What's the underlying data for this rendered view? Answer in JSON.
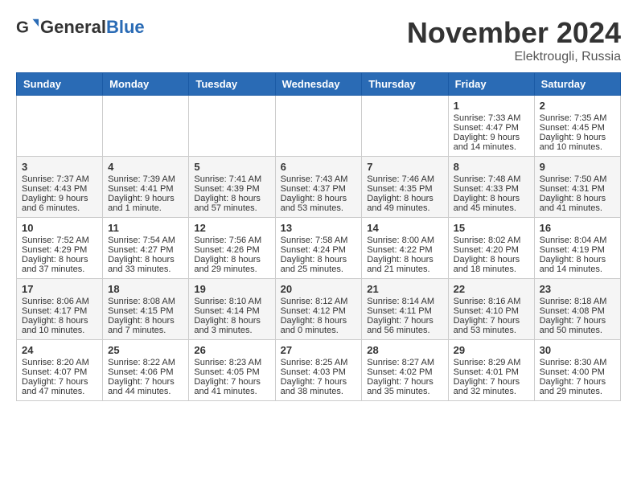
{
  "header": {
    "logo_general": "General",
    "logo_blue": "Blue",
    "month_title": "November 2024",
    "location": "Elektrougli, Russia"
  },
  "calendar": {
    "weekdays": [
      "Sunday",
      "Monday",
      "Tuesday",
      "Wednesday",
      "Thursday",
      "Friday",
      "Saturday"
    ],
    "rows": [
      [
        {
          "day": "",
          "text": ""
        },
        {
          "day": "",
          "text": ""
        },
        {
          "day": "",
          "text": ""
        },
        {
          "day": "",
          "text": ""
        },
        {
          "day": "",
          "text": ""
        },
        {
          "day": "1",
          "text": "Sunrise: 7:33 AM\nSunset: 4:47 PM\nDaylight: 9 hours and 14 minutes."
        },
        {
          "day": "2",
          "text": "Sunrise: 7:35 AM\nSunset: 4:45 PM\nDaylight: 9 hours and 10 minutes."
        }
      ],
      [
        {
          "day": "3",
          "text": "Sunrise: 7:37 AM\nSunset: 4:43 PM\nDaylight: 9 hours and 6 minutes."
        },
        {
          "day": "4",
          "text": "Sunrise: 7:39 AM\nSunset: 4:41 PM\nDaylight: 9 hours and 1 minute."
        },
        {
          "day": "5",
          "text": "Sunrise: 7:41 AM\nSunset: 4:39 PM\nDaylight: 8 hours and 57 minutes."
        },
        {
          "day": "6",
          "text": "Sunrise: 7:43 AM\nSunset: 4:37 PM\nDaylight: 8 hours and 53 minutes."
        },
        {
          "day": "7",
          "text": "Sunrise: 7:46 AM\nSunset: 4:35 PM\nDaylight: 8 hours and 49 minutes."
        },
        {
          "day": "8",
          "text": "Sunrise: 7:48 AM\nSunset: 4:33 PM\nDaylight: 8 hours and 45 minutes."
        },
        {
          "day": "9",
          "text": "Sunrise: 7:50 AM\nSunset: 4:31 PM\nDaylight: 8 hours and 41 minutes."
        }
      ],
      [
        {
          "day": "10",
          "text": "Sunrise: 7:52 AM\nSunset: 4:29 PM\nDaylight: 8 hours and 37 minutes."
        },
        {
          "day": "11",
          "text": "Sunrise: 7:54 AM\nSunset: 4:27 PM\nDaylight: 8 hours and 33 minutes."
        },
        {
          "day": "12",
          "text": "Sunrise: 7:56 AM\nSunset: 4:26 PM\nDaylight: 8 hours and 29 minutes."
        },
        {
          "day": "13",
          "text": "Sunrise: 7:58 AM\nSunset: 4:24 PM\nDaylight: 8 hours and 25 minutes."
        },
        {
          "day": "14",
          "text": "Sunrise: 8:00 AM\nSunset: 4:22 PM\nDaylight: 8 hours and 21 minutes."
        },
        {
          "day": "15",
          "text": "Sunrise: 8:02 AM\nSunset: 4:20 PM\nDaylight: 8 hours and 18 minutes."
        },
        {
          "day": "16",
          "text": "Sunrise: 8:04 AM\nSunset: 4:19 PM\nDaylight: 8 hours and 14 minutes."
        }
      ],
      [
        {
          "day": "17",
          "text": "Sunrise: 8:06 AM\nSunset: 4:17 PM\nDaylight: 8 hours and 10 minutes."
        },
        {
          "day": "18",
          "text": "Sunrise: 8:08 AM\nSunset: 4:15 PM\nDaylight: 8 hours and 7 minutes."
        },
        {
          "day": "19",
          "text": "Sunrise: 8:10 AM\nSunset: 4:14 PM\nDaylight: 8 hours and 3 minutes."
        },
        {
          "day": "20",
          "text": "Sunrise: 8:12 AM\nSunset: 4:12 PM\nDaylight: 8 hours and 0 minutes."
        },
        {
          "day": "21",
          "text": "Sunrise: 8:14 AM\nSunset: 4:11 PM\nDaylight: 7 hours and 56 minutes."
        },
        {
          "day": "22",
          "text": "Sunrise: 8:16 AM\nSunset: 4:10 PM\nDaylight: 7 hours and 53 minutes."
        },
        {
          "day": "23",
          "text": "Sunrise: 8:18 AM\nSunset: 4:08 PM\nDaylight: 7 hours and 50 minutes."
        }
      ],
      [
        {
          "day": "24",
          "text": "Sunrise: 8:20 AM\nSunset: 4:07 PM\nDaylight: 7 hours and 47 minutes."
        },
        {
          "day": "25",
          "text": "Sunrise: 8:22 AM\nSunset: 4:06 PM\nDaylight: 7 hours and 44 minutes."
        },
        {
          "day": "26",
          "text": "Sunrise: 8:23 AM\nSunset: 4:05 PM\nDaylight: 7 hours and 41 minutes."
        },
        {
          "day": "27",
          "text": "Sunrise: 8:25 AM\nSunset: 4:03 PM\nDaylight: 7 hours and 38 minutes."
        },
        {
          "day": "28",
          "text": "Sunrise: 8:27 AM\nSunset: 4:02 PM\nDaylight: 7 hours and 35 minutes."
        },
        {
          "day": "29",
          "text": "Sunrise: 8:29 AM\nSunset: 4:01 PM\nDaylight: 7 hours and 32 minutes."
        },
        {
          "day": "30",
          "text": "Sunrise: 8:30 AM\nSunset: 4:00 PM\nDaylight: 7 hours and 29 minutes."
        }
      ]
    ]
  }
}
